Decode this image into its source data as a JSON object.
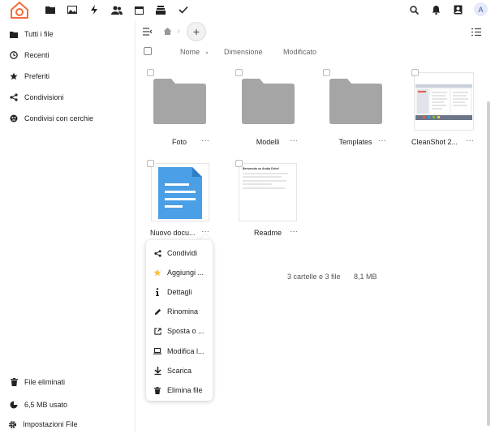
{
  "app": {
    "avatar_letter": "A"
  },
  "topnav": {
    "icons": [
      "files-icon",
      "photos-icon",
      "activity-icon",
      "contacts-icon",
      "calendar-icon",
      "deck-icon",
      "tasks-icon"
    ],
    "right_icons": [
      "search-icon",
      "notifications-icon",
      "contacts-menu-icon"
    ]
  },
  "sidebar": {
    "items": [
      {
        "label": "Tutti i file",
        "icon": "folder-icon"
      },
      {
        "label": "Recenti",
        "icon": "clock-icon"
      },
      {
        "label": "Preferiti",
        "icon": "star-icon"
      },
      {
        "label": "Condivisioni",
        "icon": "share-icon"
      },
      {
        "label": "Condivisi con cerchie",
        "icon": "circles-icon"
      }
    ],
    "deleted": "File eliminati",
    "quota": "6,5 MB usato",
    "settings": "Impostazioni File"
  },
  "list_header": {
    "name": "Nome",
    "sort_arrow": "▲",
    "size": "Dimensione",
    "modified": "Modificato"
  },
  "files": [
    {
      "name": "Foto",
      "type": "folder"
    },
    {
      "name": "Modelli",
      "type": "folder"
    },
    {
      "name": "Templates",
      "type": "folder"
    },
    {
      "name": "CleanShot 2...",
      "type": "image"
    },
    {
      "name": "Nuovo docu...",
      "type": "document"
    },
    {
      "name": "Readme",
      "type": "text"
    }
  ],
  "more_label": "···",
  "readme_preview": "Benvenuto su Aruba Drive!",
  "summary": {
    "counts": "3 cartelle e 3 file",
    "size": "8,1 MB"
  },
  "context_menu": {
    "items": [
      {
        "label": "Condividi",
        "icon": "share-icon"
      },
      {
        "label": "Aggiungi ...",
        "icon": "star-icon"
      },
      {
        "label": "Dettagli",
        "icon": "info-icon"
      },
      {
        "label": "Rinomina",
        "icon": "pencil-icon"
      },
      {
        "label": "Sposta o ...",
        "icon": "move-icon"
      },
      {
        "label": "Modifica l...",
        "icon": "laptop-icon"
      },
      {
        "label": "Scarica",
        "icon": "download-icon"
      },
      {
        "label": "Elimina file",
        "icon": "trash-icon"
      }
    ]
  },
  "colors": {
    "brand_orange": "#f26d3d",
    "folder_gray": "#a5a5a5",
    "doc_blue": "#4a9fe6",
    "star_yellow": "#f6c343"
  }
}
